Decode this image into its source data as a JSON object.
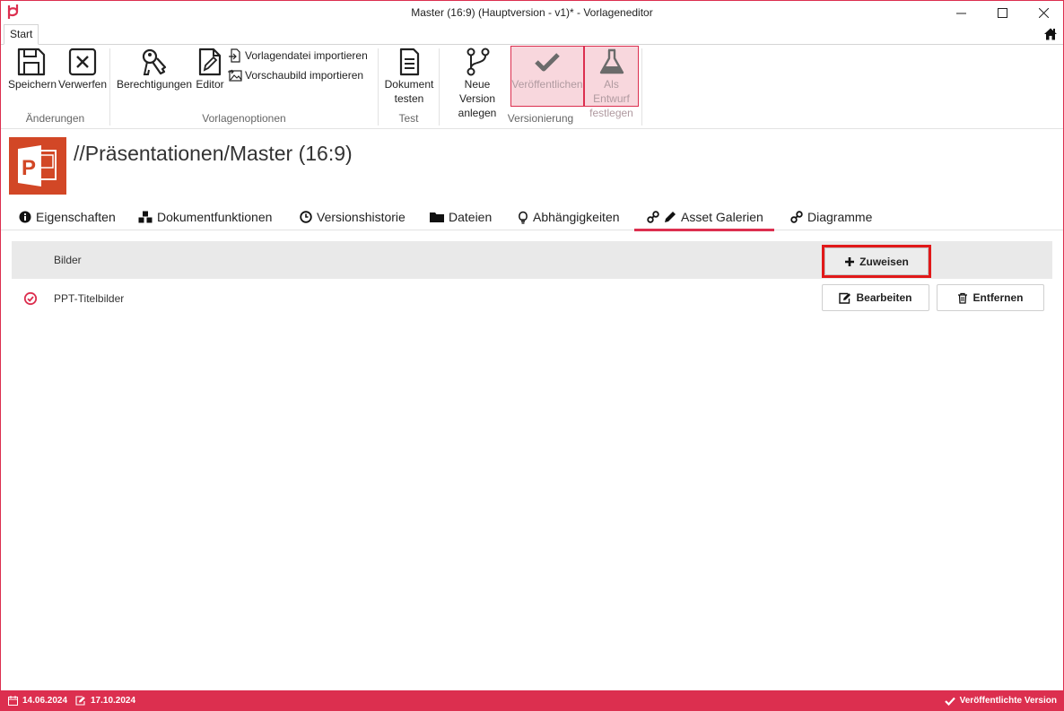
{
  "window": {
    "title": "Master (16:9) (Hauptversion - v1)* - Vorlageneditor",
    "tab": "Start"
  },
  "ribbon": {
    "save": "Speichern",
    "discard": "Verwerfen",
    "permissions": "Berechtigungen",
    "editor": "Editor",
    "import_template": "Vorlagendatei importieren",
    "import_preview": "Vorschaubild importieren",
    "test_doc_1": "Dokument",
    "test_doc_2": "testen",
    "new_version_1": "Neue Version",
    "new_version_2": "anlegen",
    "publish": "Veröffentlichen",
    "draft_1": "Als Entwurf",
    "draft_2": "festlegen",
    "groups": {
      "changes": "Änderungen",
      "template_options": "Vorlagenoptionen",
      "test": "Test",
      "versioning": "Versionierung"
    }
  },
  "header": {
    "title": "//Präsentationen/Master (16:9)"
  },
  "tabs": [
    {
      "label": "Eigenschaften",
      "icon": "info-icon"
    },
    {
      "label": "Dokumentfunktionen",
      "icon": "cubes-icon"
    },
    {
      "label": "Versionshistorie",
      "icon": "clock-icon"
    },
    {
      "label": "Dateien",
      "icon": "folder-icon"
    },
    {
      "label": "Abhängigkeiten",
      "icon": "lightbulb-icon"
    },
    {
      "label": "Asset Galerien",
      "icon": "pencil-icon",
      "active": true
    },
    {
      "label": "Diagramme",
      "icon": "link-icon"
    }
  ],
  "table": {
    "column": "Bilder",
    "assign": "Zuweisen",
    "rows": [
      {
        "name": "PPT-Titelbilder",
        "edit": "Bearbeiten",
        "remove": "Entfernen"
      }
    ]
  },
  "status": {
    "created": "14.06.2024",
    "modified": "17.10.2024",
    "state": "Veröffentlichte Version"
  },
  "colors": {
    "accent": "#dc2f4f",
    "highlight": "#e1191a",
    "doc_icon": "#d24726"
  }
}
